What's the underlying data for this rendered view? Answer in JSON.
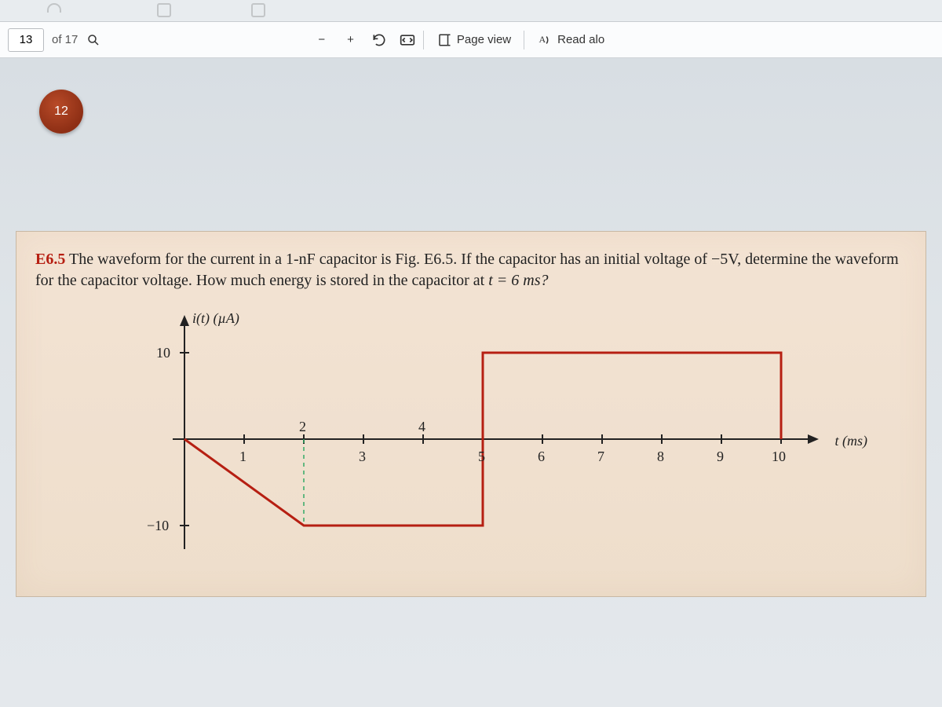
{
  "toolbar": {
    "page_current": "13",
    "page_total": "of 17",
    "zoom_minus": "−",
    "zoom_plus": "+",
    "page_view_label": "Page view",
    "read_aloud_label": "Read alo"
  },
  "thumb_badge": "12",
  "problem": {
    "number": "E6.5",
    "text_1": "The waveform for the current in a 1-nF capacitor is Fig. E6.5. If the capacitor has an initial voltage of −5V, determine the waveform for the capacitor voltage. How much energy is stored in the capacitor at",
    "t_expr": "t = 6 ms?"
  },
  "chart_data": {
    "type": "line",
    "title": "",
    "ylabel": "i(t) (µA)",
    "xlabel": "t (ms)",
    "x_ticks": [
      1,
      2,
      3,
      4,
      5,
      6,
      7,
      8,
      9,
      10
    ],
    "y_ticks": [
      -10,
      10
    ],
    "xlim": [
      0,
      10.8
    ],
    "ylim": [
      -12,
      12
    ],
    "series": [
      {
        "name": "i(t)",
        "points": [
          {
            "x": 0,
            "y": 0
          },
          {
            "x": 2,
            "y": -10
          },
          {
            "x": 5,
            "y": -10
          },
          {
            "x": 5,
            "y": 10
          },
          {
            "x": 10,
            "y": 10
          },
          {
            "x": 10,
            "y": 0
          }
        ]
      }
    ],
    "line_color": "#b61f12"
  }
}
